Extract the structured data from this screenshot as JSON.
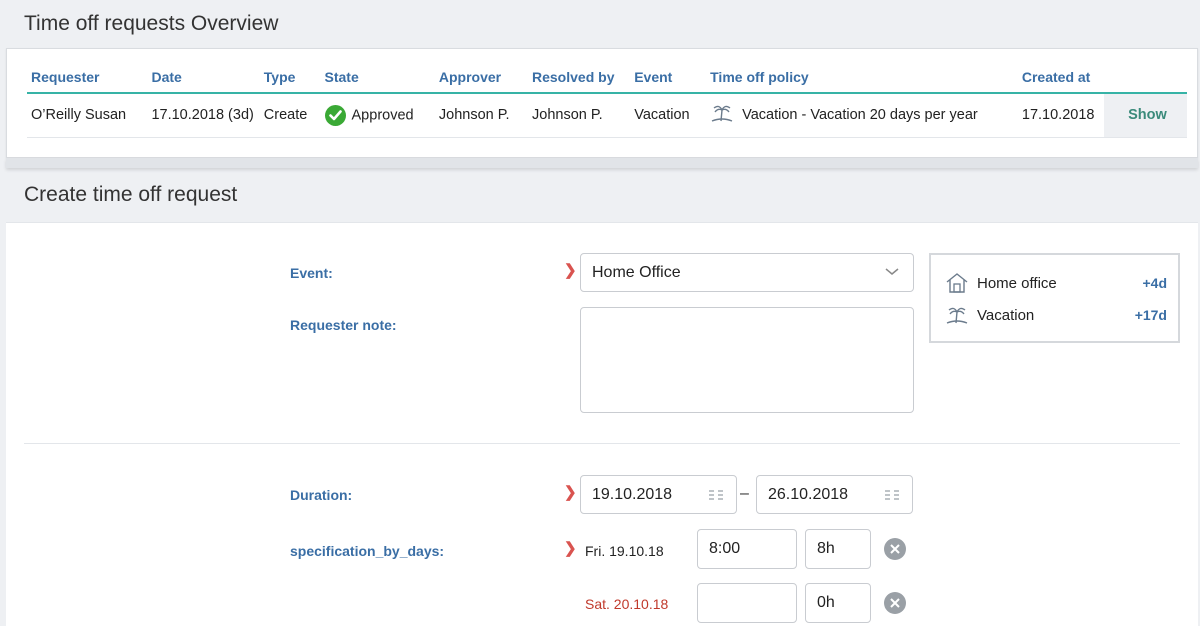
{
  "overview": {
    "title": "Time off requests Overview",
    "columns": [
      "Requester",
      "Date",
      "Type",
      "State",
      "Approver",
      "Resolved by",
      "Event",
      "Time off policy",
      "Created at"
    ],
    "rows": [
      {
        "requester": "O’Reilly Susan",
        "date": "17.10.2018 (3d)",
        "type": "Create",
        "state": "Approved",
        "approver": "Johnson P.",
        "resolved_by": "Johnson P.",
        "event": "Vacation",
        "policy": "Vacation - Vacation 20 days per year",
        "created_at": "17.10.2018",
        "action": "Show"
      }
    ]
  },
  "create": {
    "title": "Create time off request",
    "event_label": "Event:",
    "event_value": "Home Office",
    "note_label": "Requester note:",
    "note_value": "",
    "duration_label": "Duration:",
    "duration_from": "19.10.2018",
    "duration_to": "26.10.2018",
    "duration_sep": "–",
    "spec_label": "specification_by_days:",
    "days": [
      {
        "label": "Fri. 19.10.18",
        "start": "8:00",
        "hours": "8h",
        "color": "#222222"
      },
      {
        "label": "Sat. 20.10.18",
        "start": "",
        "hours": "0h",
        "color": "#c0392b"
      }
    ],
    "balances": [
      {
        "name": "Home office",
        "value": "+4d",
        "icon": "house-icon"
      },
      {
        "name": "Vacation",
        "value": "+17d",
        "icon": "palm-tree-icon"
      }
    ]
  },
  "colors": {
    "accent": "#3a6ea5",
    "teal": "#36b3a6",
    "approved": "#3aa935",
    "weekend": "#c0392b",
    "required": "#d9534f"
  }
}
